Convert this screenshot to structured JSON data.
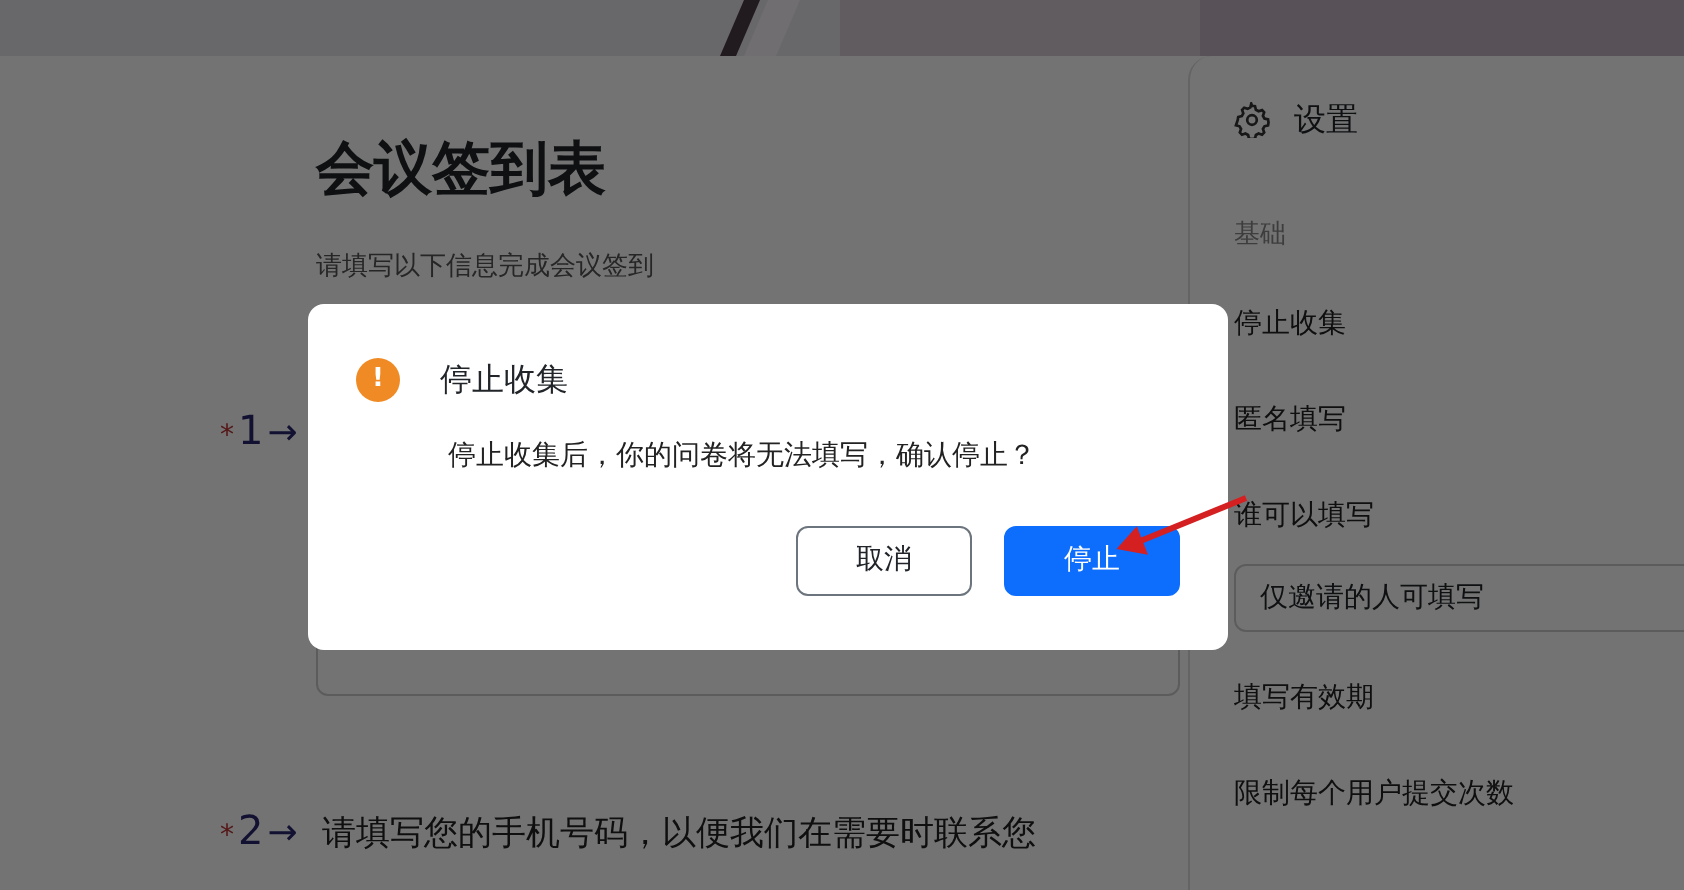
{
  "form": {
    "title": "会议签到表",
    "description": "请填写以下信息完成会议签到",
    "questions": [
      {
        "marker": "*",
        "number": "1",
        "arrow": "→",
        "kind": "field"
      },
      {
        "marker": "*",
        "number": "2",
        "arrow": "→",
        "kind": "plain",
        "text": "请填写您的手机号码，以便我们在需要时联系您"
      }
    ]
  },
  "settings": {
    "title": "设置",
    "section": "基础",
    "items": [
      {
        "kind": "label",
        "label": "停止收集"
      },
      {
        "kind": "label",
        "label": "匿名填写"
      },
      {
        "kind": "label",
        "label": "谁可以填写"
      },
      {
        "kind": "select",
        "value": "仅邀请的人可填写"
      },
      {
        "kind": "label",
        "label": "填写有效期"
      },
      {
        "kind": "label",
        "label": "限制每个用户提交次数"
      }
    ]
  },
  "dialog": {
    "icon_text": "!",
    "title": "停止收集",
    "message": "停止收集后，你的问卷将无法填写，确认停止？",
    "buttons": [
      {
        "label": "取消",
        "kind": "secondary"
      },
      {
        "label": "停止",
        "kind": "primary"
      }
    ]
  }
}
